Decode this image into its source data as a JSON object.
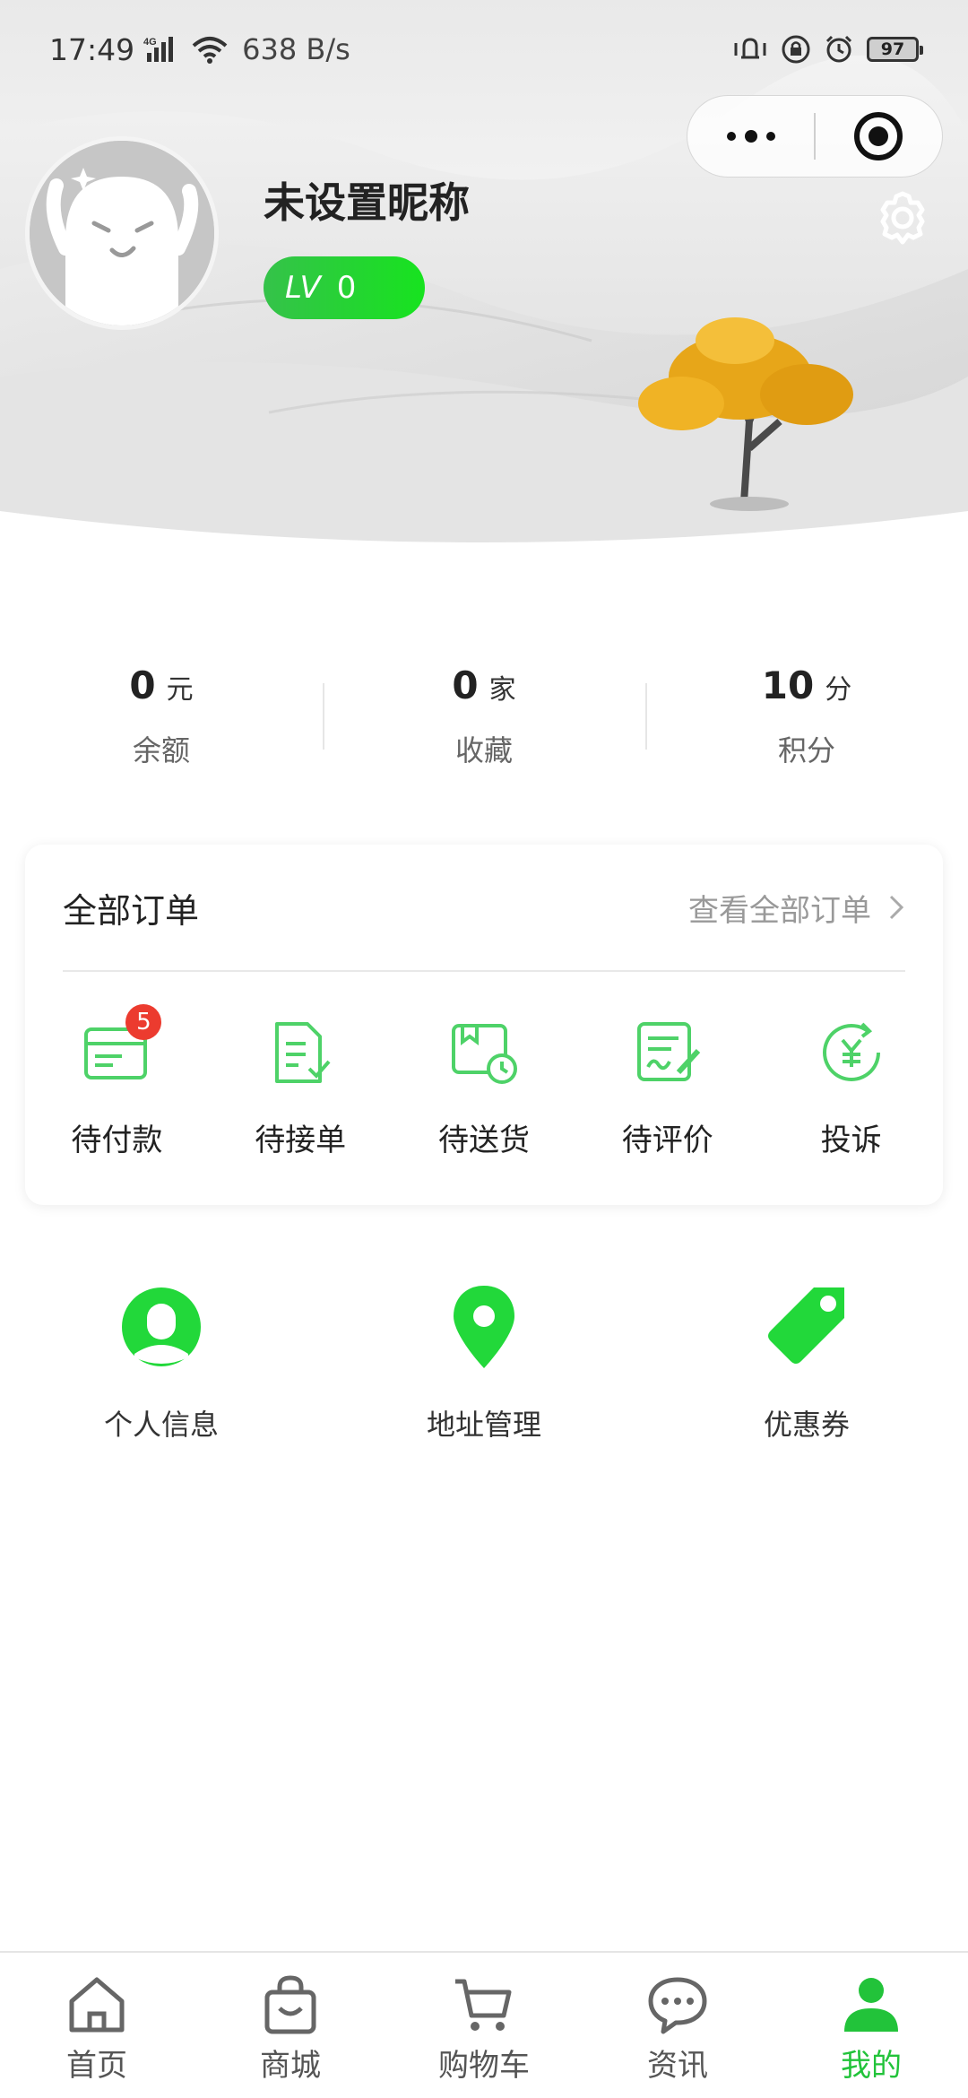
{
  "status_bar": {
    "time": "17:49",
    "signal_label": "4G",
    "speed": "638 B/s",
    "battery": "97"
  },
  "profile": {
    "nickname": "未设置昵称",
    "level_prefix": "LV",
    "level_value": "0"
  },
  "stats": [
    {
      "value": "0",
      "unit": "元",
      "label": "余额"
    },
    {
      "value": "0",
      "unit": "家",
      "label": "收藏"
    },
    {
      "value": "10",
      "unit": "分",
      "label": "积分"
    }
  ],
  "orders": {
    "title": "全部订单",
    "view_all": "查看全部订单",
    "items": [
      {
        "label": "待付款",
        "icon": "card-icon",
        "badge": "5"
      },
      {
        "label": "待接单",
        "icon": "document-check-icon"
      },
      {
        "label": "待送货",
        "icon": "delivery-clock-icon"
      },
      {
        "label": "待评价",
        "icon": "review-pen-icon"
      },
      {
        "label": "投诉",
        "icon": "yuan-refund-icon"
      }
    ]
  },
  "services": [
    {
      "label": "个人信息",
      "icon": "person-icon"
    },
    {
      "label": "地址管理",
      "icon": "location-pin-icon"
    },
    {
      "label": "优惠券",
      "icon": "coupon-tag-icon"
    }
  ],
  "tabbar": [
    {
      "label": "首页",
      "icon": "home-icon"
    },
    {
      "label": "商城",
      "icon": "shopping-bag-icon"
    },
    {
      "label": "购物车",
      "icon": "cart-icon"
    },
    {
      "label": "资讯",
      "icon": "chat-icon"
    },
    {
      "label": "我的",
      "icon": "user-icon",
      "active": true
    }
  ],
  "colors": {
    "accent": "#22c33a",
    "icon_green": "#4ed268",
    "badge_red": "#ec3b2f"
  }
}
